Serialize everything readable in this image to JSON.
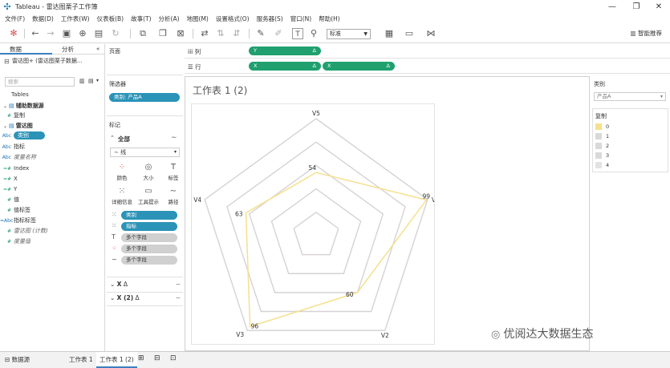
{
  "window": {
    "title": "Tableau - 雷达图栗子工作簿",
    "controls": [
      "—",
      "❐",
      "✕"
    ]
  },
  "menu": [
    "文件(F)",
    "数据(D)",
    "工作表(W)",
    "仪表板(B)",
    "故事(T)",
    "分析(A)",
    "地图(M)",
    "设置格式(O)",
    "服务器(S)",
    "窗口(N)",
    "帮助(H)"
  ],
  "toolbar": {
    "fit_label": "标准",
    "recommend_label": "智能推荐"
  },
  "datapane": {
    "tab_data": "数据",
    "tab_analysis": "分析",
    "datasource": "雷达图+ (雷达图栗子数据...",
    "search_placeholder": "搜索",
    "tables_label": "Tables",
    "group1": "辅助数据源",
    "group1_item": "复制",
    "group2": "雷达图",
    "fields": [
      {
        "type": "Abc",
        "name": "类别"
      },
      {
        "type": "Abc",
        "name": "指标"
      },
      {
        "type": "Abc",
        "name": "度量名称"
      },
      {
        "type": "=#",
        "name": "Index"
      },
      {
        "type": "=#",
        "name": "X"
      },
      {
        "type": "=#",
        "name": "Y"
      },
      {
        "type": "#",
        "name": "值"
      },
      {
        "type": "#",
        "name": "值标签"
      },
      {
        "type": "=Abc",
        "name": "指标标签"
      },
      {
        "type": "#",
        "name": "雷达图 (计数)"
      },
      {
        "type": "#",
        "name": "度量值"
      }
    ]
  },
  "pages_label": "页面",
  "filters_label": "筛选器",
  "filter_pill": "类别: 产品A",
  "marks": {
    "label": "标记",
    "all_label": "全部",
    "mark_type": "线",
    "buttons": [
      "颜色",
      "大小",
      "标签",
      "详细信息",
      "工具提示",
      "路径"
    ],
    "pills": [
      "类别",
      "指标",
      "多个字段",
      "多个字段",
      "多个字段"
    ],
    "cards": [
      "X",
      "X (2)"
    ]
  },
  "shelves": {
    "columns_label": "列",
    "rows_label": "行",
    "col_pill": "Y",
    "row_pills": [
      "X",
      "X"
    ]
  },
  "sheet_title": "工作表 1 (2)",
  "chart_data": {
    "type": "radar",
    "axes": [
      "V1",
      "V2",
      "V3",
      "V4",
      "V5"
    ],
    "data_labels": {
      "V1": 99,
      "V2": 60,
      "V3": 96,
      "V4": 63,
      "V5": 54
    },
    "series": [
      {
        "values": [
          99,
          60,
          96,
          63,
          54
        ],
        "color": "#f5e08c"
      }
    ],
    "grid_levels": 4,
    "grid_color": "#d6d2d6"
  },
  "legend_category": {
    "title": "类别",
    "selected": "产品A"
  },
  "legend_copy": {
    "title": "复制",
    "items": [
      {
        "label": "0",
        "color": "#f5e08c"
      },
      {
        "label": "1",
        "color": "#d9d9d9"
      },
      {
        "label": "2",
        "color": "#d9d9d9"
      },
      {
        "label": "3",
        "color": "#d9d9d9"
      },
      {
        "label": "4",
        "color": "#e3e3e3"
      }
    ]
  },
  "bottom_tabs": {
    "datasource": "数据源",
    "sheet1": "工作表 1",
    "sheet2": "工作表 1 (2)"
  },
  "watermark": "优阅达大数据生态"
}
